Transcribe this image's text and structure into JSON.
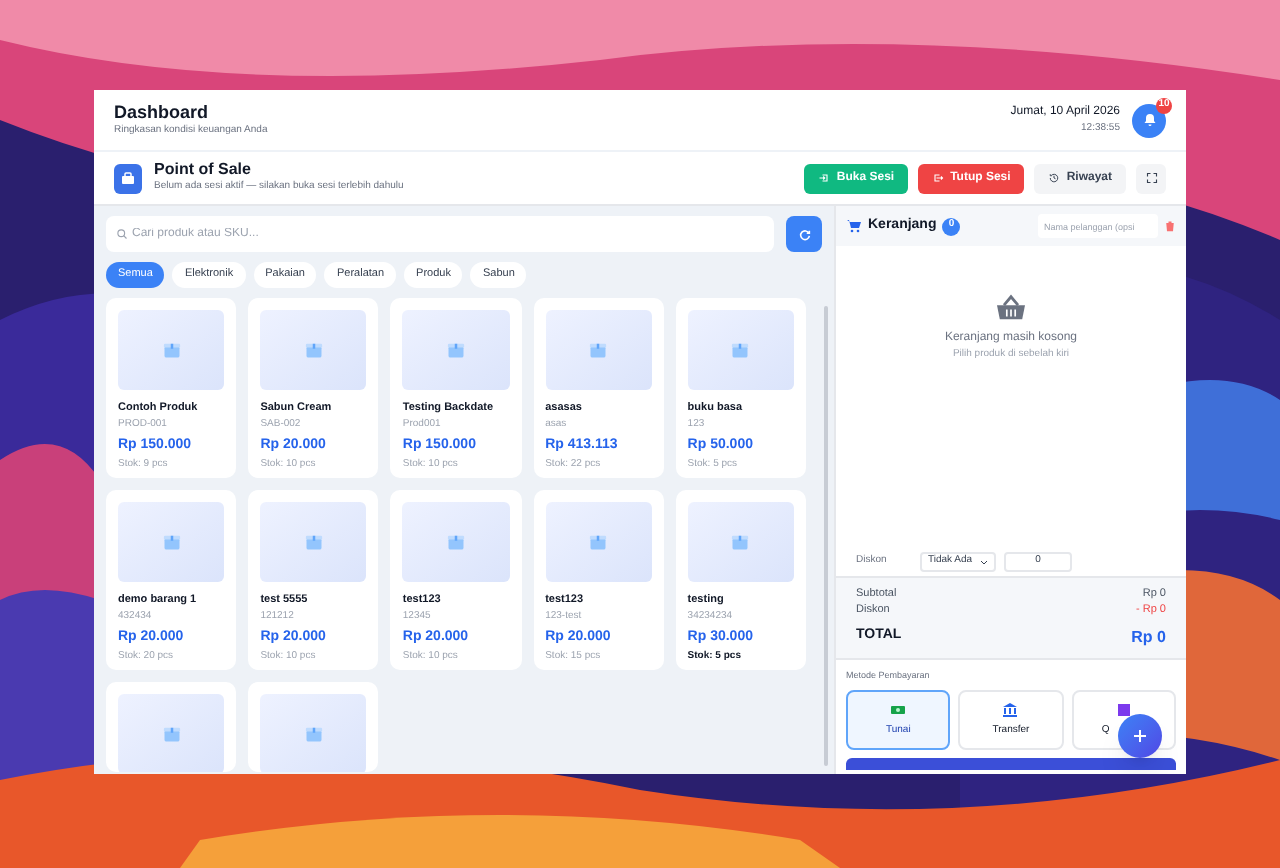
{
  "header": {
    "title": "Dashboard",
    "subtitle": "Ringkasan kondisi keuangan Anda",
    "date": "Jumat, 10 April 2026",
    "time": "12:38:55",
    "notifications": "10"
  },
  "pos": {
    "title": "Point of Sale",
    "subtitle": "Belum ada sesi aktif — silakan buka sesi terlebih dahulu",
    "buttons": [
      {
        "label": "Buka Sesi",
        "kind": "open"
      },
      {
        "label": "Tutup Sesi",
        "kind": "close"
      },
      {
        "label": "Riwayat",
        "kind": "history"
      }
    ]
  },
  "search": {
    "placeholder": "Cari produk atau SKU..."
  },
  "categories": [
    {
      "label": "Semua",
      "selected": true
    },
    {
      "label": "Elektronik",
      "selected": false
    },
    {
      "label": "Pakaian",
      "selected": false
    },
    {
      "label": "Peralatan",
      "selected": false
    },
    {
      "label": "Produk",
      "selected": false
    },
    {
      "label": "Sabun",
      "selected": false
    }
  ],
  "products": [
    {
      "name": "Contoh Produk",
      "sku": "PROD-001",
      "price": "Rp 150.000",
      "stock": "Stok: 9 pcs",
      "low_stock": false
    },
    {
      "name": "Sabun Cream",
      "sku": "SAB-002",
      "price": "Rp 20.000",
      "stock": "Stok: 10 pcs",
      "low_stock": false
    },
    {
      "name": "Testing Backdate",
      "sku": "Prod001",
      "price": "Rp 150.000",
      "stock": "Stok: 10 pcs",
      "low_stock": false
    },
    {
      "name": "asasas",
      "sku": "asas",
      "price": "Rp 413.113",
      "stock": "Stok: 22 pcs",
      "low_stock": false
    },
    {
      "name": "buku basa",
      "sku": "123",
      "price": "Rp 50.000",
      "stock": "Stok: 5 pcs",
      "low_stock": false
    },
    {
      "name": "demo barang 1",
      "sku": "432434",
      "price": "Rp 20.000",
      "stock": "Stok: 20 pcs",
      "low_stock": false
    },
    {
      "name": "test 5555",
      "sku": "121212",
      "price": "Rp 20.000",
      "stock": "Stok: 10 pcs",
      "low_stock": false
    },
    {
      "name": "test123",
      "sku": "12345",
      "price": "Rp 20.000",
      "stock": "Stok: 10 pcs",
      "low_stock": false
    },
    {
      "name": "test123",
      "sku": "123-test",
      "price": "Rp 20.000",
      "stock": "Stok: 15 pcs",
      "low_stock": false
    },
    {
      "name": "testing",
      "sku": "34234234",
      "price": "Rp 30.000",
      "stock": "Stok: 5 pcs",
      "low_stock": true
    },
    {
      "kind": "cut"
    },
    {
      "kind": "cut"
    }
  ],
  "cart": {
    "title": "Keranjang",
    "count": "0",
    "customer_placeholder": "Nama pelanggan (opsi",
    "empty_title": "Keranjang masih kosong",
    "empty_hint": "Pilih produk di sebelah kiri"
  },
  "discount": {
    "label": "Diskon",
    "type": "Tidak Ada",
    "value": "0"
  },
  "totals": [
    {
      "label": "Subtotal",
      "value": "Rp 0",
      "kind": "normal"
    },
    {
      "label": "Diskon",
      "value": "- Rp 0",
      "kind": "discount"
    },
    {
      "label": "TOTAL",
      "value": "Rp 0",
      "kind": "total"
    }
  ],
  "payment": {
    "label": "Metode Pembayaran",
    "methods": [
      {
        "label": "Tunai",
        "kind": "cash",
        "selected": true
      },
      {
        "label": "Transfer",
        "kind": "bank",
        "selected": false
      },
      {
        "label": "Q",
        "kind": "qr",
        "selected": false
      }
    ]
  }
}
